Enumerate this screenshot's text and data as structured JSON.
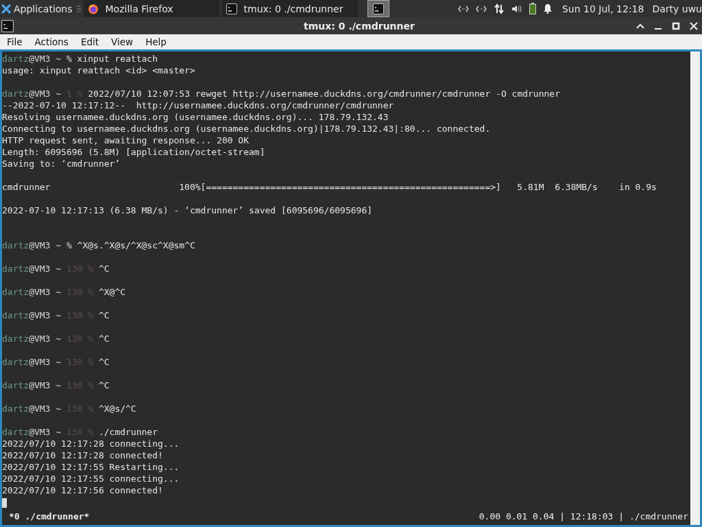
{
  "panel": {
    "apps_label": "Applications",
    "tasks": [
      {
        "label": "Mozilla Firefox",
        "kind": "firefox",
        "selected": false
      },
      {
        "label": "tmux: 0 ./cmdrunner",
        "kind": "terminal",
        "selected": false
      },
      {
        "kind": "terminal",
        "selected": true
      }
    ],
    "clock": "Sun 10 Jul, 12:18",
    "user": "Darty uwu"
  },
  "window": {
    "title": "tmux: 0 ./cmdrunner"
  },
  "menu": [
    "File",
    "Actions",
    "Edit",
    "View",
    "Help"
  ],
  "terminal": {
    "lines": [
      {
        "kind": "prompt",
        "user": "dartz",
        "host": "@VM3",
        "cwd": "~",
        "sigil": "%",
        "command": "xinput reattach"
      },
      {
        "kind": "output",
        "text": "usage: xinput reattach <id> <master>"
      },
      {
        "kind": "blank"
      },
      {
        "kind": "prompt",
        "user": "dartz",
        "host": "@VM3",
        "cwd": "~",
        "status": "1",
        "sigil": "%",
        "command": "2022/07/10 12:07:53 rewget http://usernamee.duckdns.org/cmdrunner/cmdrunner -O cmdrunner"
      },
      {
        "kind": "output",
        "text": "--2022-07-10 12:17:12--  http://usernamee.duckdns.org/cmdrunner/cmdrunner"
      },
      {
        "kind": "output",
        "text": "Resolving usernamee.duckdns.org (usernamee.duckdns.org)... 178.79.132.43"
      },
      {
        "kind": "output",
        "text": "Connecting to usernamee.duckdns.org (usernamee.duckdns.org)|178.79.132.43|:80... connected."
      },
      {
        "kind": "output",
        "text": "HTTP request sent, awaiting response... 200 OK"
      },
      {
        "kind": "output",
        "text": "Length: 6095696 (5.8M) [application/octet-stream]"
      },
      {
        "kind": "output",
        "text": "Saving to: ‘cmdrunner’"
      },
      {
        "kind": "blank"
      },
      {
        "kind": "output",
        "text": "cmdrunner                        100%[=====================================================>]   5.81M  6.38MB/s    in 0.9s"
      },
      {
        "kind": "blank"
      },
      {
        "kind": "output",
        "text": "2022-07-10 12:17:13 (6.38 MB/s) - ‘cmdrunner’ saved [6095696/6095696]"
      },
      {
        "kind": "blank"
      },
      {
        "kind": "blank"
      },
      {
        "kind": "prompt",
        "user": "dartz",
        "host": "@VM3",
        "cwd": "~",
        "sigil": "%",
        "command": "^X@s.^X@s/^X@sc^X@sm^C"
      },
      {
        "kind": "blank"
      },
      {
        "kind": "prompt",
        "user": "dartz",
        "host": "@VM3",
        "cwd": "~",
        "status": "130",
        "sigil": "%",
        "command": "^C"
      },
      {
        "kind": "blank"
      },
      {
        "kind": "prompt",
        "user": "dartz",
        "host": "@VM3",
        "cwd": "~",
        "status": "130",
        "sigil": "%",
        "command": "^X@^C"
      },
      {
        "kind": "blank"
      },
      {
        "kind": "prompt",
        "user": "dartz",
        "host": "@VM3",
        "cwd": "~",
        "status": "130",
        "sigil": "%",
        "command": "^C"
      },
      {
        "kind": "blank"
      },
      {
        "kind": "prompt",
        "user": "dartz",
        "host": "@VM3",
        "cwd": "~",
        "status": "130",
        "sigil": "%",
        "command": "^C"
      },
      {
        "kind": "blank"
      },
      {
        "kind": "prompt",
        "user": "dartz",
        "host": "@VM3",
        "cwd": "~",
        "status": "130",
        "sigil": "%",
        "command": "^C"
      },
      {
        "kind": "blank"
      },
      {
        "kind": "prompt",
        "user": "dartz",
        "host": "@VM3",
        "cwd": "~",
        "status": "130",
        "sigil": "%",
        "command": "^C"
      },
      {
        "kind": "blank"
      },
      {
        "kind": "prompt",
        "user": "dartz",
        "host": "@VM3",
        "cwd": "~",
        "status": "130",
        "sigil": "%",
        "command": "^X@s/^C"
      },
      {
        "kind": "blank"
      },
      {
        "kind": "prompt",
        "user": "dartz",
        "host": "@VM3",
        "cwd": "~",
        "status": "130",
        "sigil": "%",
        "command": "./cmdrunner"
      },
      {
        "kind": "output",
        "text": "2022/07/10 12:17:28 connecting..."
      },
      {
        "kind": "output",
        "text": "2022/07/10 12:17:28 connected!"
      },
      {
        "kind": "output",
        "text": "2022/07/10 12:17:55 Restarting..."
      },
      {
        "kind": "output",
        "text": "2022/07/10 12:17:55 connecting..."
      },
      {
        "kind": "output",
        "text": "2022/07/10 12:17:56 connected!"
      },
      {
        "kind": "cursor"
      }
    ]
  },
  "tmux_status": {
    "left": "*0 ./cmdrunner*",
    "right": "0.00 0.01 0.04 | 12:18:03 | ./cmdrunner"
  }
}
